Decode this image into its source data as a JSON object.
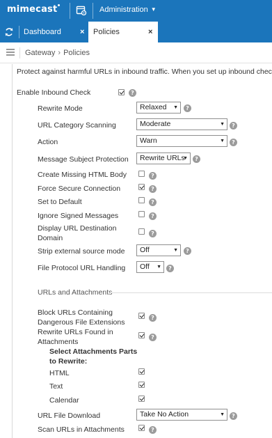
{
  "topbar": {
    "logo": "mimecast",
    "admin_menu": "Administration",
    "icons": {
      "admin": "admin-console-icon",
      "caret": "chevron-down-icon"
    }
  },
  "tabs": [
    {
      "label": "Dashboard",
      "close": "×",
      "active": false
    },
    {
      "label": "Policies",
      "close": "×",
      "active": true
    }
  ],
  "breadcrumb": [
    "Gateway",
    "Policies"
  ],
  "description": "Protect against harmful URLs in inbound traffic. When you set up inbound checks, u",
  "enable_inbound_check": {
    "label": "Enable Inbound Check",
    "checked": true
  },
  "settings": {
    "rewrite_mode": {
      "label": "Rewrite Mode",
      "value": "Relaxed"
    },
    "url_category_scanning": {
      "label": "URL Category Scanning",
      "value": "Moderate"
    },
    "action": {
      "label": "Action",
      "value": "Warn"
    },
    "message_subject_protection": {
      "label": "Message Subject Protection",
      "value": "Rewrite URLs"
    },
    "create_missing_html_body": {
      "label": "Create Missing HTML Body",
      "checked": false
    },
    "force_secure_connection": {
      "label": "Force Secure Connection",
      "checked": true
    },
    "set_to_default": {
      "label": "Set to Default",
      "checked": false
    },
    "ignore_signed_messages": {
      "label": "Ignore Signed Messages",
      "checked": false
    },
    "display_url_destination_domain": {
      "label_line1": "Display URL Destination",
      "label_line2": "Domain",
      "checked": false
    },
    "strip_external_source_mode": {
      "label": "Strip external source mode",
      "value": "Off"
    },
    "file_protocol_url_handling": {
      "label": "File Protocol URL Handling",
      "value": "Off"
    }
  },
  "urls_and_attachments": {
    "section_title": "URLs and Attachments",
    "block_urls": {
      "label_line1": "Block URLs Containing",
      "label_line2": "Dangerous File Extensions",
      "checked": true
    },
    "rewrite_urls_attachments": {
      "label_line1": "Rewrite URLs Found in",
      "label_line2": "Attachments",
      "checked": true
    },
    "select_parts": {
      "label_line1": "Select Attachments Parts",
      "label_line2": "to Rewrite:"
    },
    "parts": [
      {
        "label": "HTML",
        "checked": true
      },
      {
        "label": "Text",
        "checked": true
      },
      {
        "label": "Calendar",
        "checked": true
      }
    ],
    "url_file_download": {
      "label": "URL File Download",
      "value": "Take No Action"
    },
    "scan_urls_in_attachments": {
      "label": "Scan URLs in Attachments",
      "checked": true
    }
  },
  "help_glyph": "?",
  "colors": {
    "brand_blue": "#1b75bb",
    "help_gray": "#9b9b9b"
  }
}
